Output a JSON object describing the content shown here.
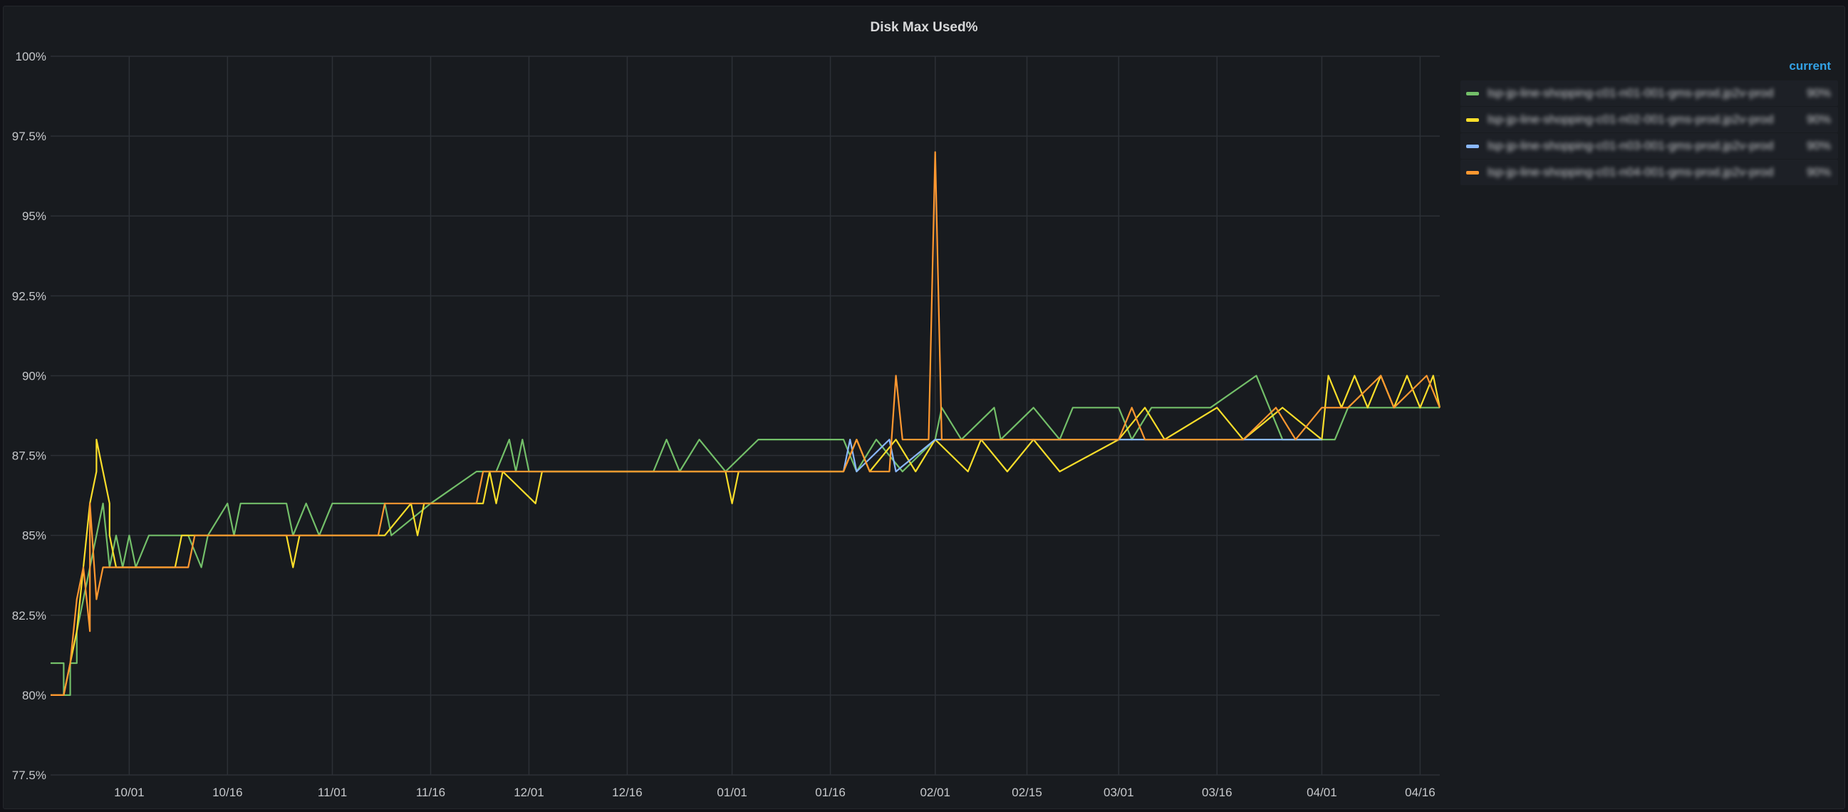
{
  "panel": {
    "title": "Disk Max Used%"
  },
  "legend": {
    "header": "current",
    "items": [
      {
        "name": "lsp-jp-line-shopping-c01-n01-001-gms-prod.jp2v-prod",
        "value": "90%",
        "color": "#73bf69"
      },
      {
        "name": "lsp-jp-line-shopping-c01-n02-001-gms-prod.jp2v-prod",
        "value": "90%",
        "color": "#fade2a"
      },
      {
        "name": "lsp-jp-line-shopping-c01-n03-001-gms-prod.jp2v-prod",
        "value": "90%",
        "color": "#8ab8ff"
      },
      {
        "name": "lsp-jp-line-shopping-c01-n04-001-gms-prod.jp2v-prod",
        "value": "90%",
        "color": "#ff9830"
      }
    ]
  },
  "chart_data": {
    "type": "line",
    "title": "Disk Max Used%",
    "y_ticks": [
      "77.5%",
      "80%",
      "82.5%",
      "85%",
      "87.5%",
      "90%",
      "92.5%",
      "95%",
      "97.5%",
      "100%"
    ],
    "x_ticks": [
      "10/01",
      "10/16",
      "11/01",
      "11/16",
      "12/01",
      "12/16",
      "01/01",
      "01/16",
      "02/01",
      "02/15",
      "03/01",
      "03/16",
      "04/01",
      "04/16"
    ],
    "ylim": [
      77.5,
      100
    ],
    "grid": true,
    "legend_position": "right",
    "series": [
      {
        "name": "lsp-jp-line-shopping-c01-n01-001-gms-prod.jp2v-prod",
        "color": "#73bf69",
        "points": [
          [
            "09/19",
            81
          ],
          [
            "09/21",
            81
          ],
          [
            "09/21",
            80
          ],
          [
            "09/22",
            80
          ],
          [
            "09/22",
            81
          ],
          [
            "09/23",
            81
          ],
          [
            "09/23",
            82
          ],
          [
            "09/24",
            83
          ],
          [
            "09/25",
            84
          ],
          [
            "09/26",
            85
          ],
          [
            "09/27",
            86
          ],
          [
            "09/28",
            84
          ],
          [
            "09/29",
            85
          ],
          [
            "09/30",
            84
          ],
          [
            "10/01",
            85
          ],
          [
            "10/02",
            84
          ],
          [
            "10/04",
            85
          ],
          [
            "10/10",
            85
          ],
          [
            "10/12",
            84
          ],
          [
            "10/13",
            85
          ],
          [
            "10/16",
            86
          ],
          [
            "10/17",
            85
          ],
          [
            "10/18",
            86
          ],
          [
            "10/25",
            86
          ],
          [
            "10/26",
            85
          ],
          [
            "10/28",
            86
          ],
          [
            "10/30",
            85
          ],
          [
            "11/01",
            86
          ],
          [
            "11/09",
            86
          ],
          [
            "11/10",
            85
          ],
          [
            "11/16",
            86
          ],
          [
            "11/23",
            87
          ],
          [
            "11/26",
            87
          ],
          [
            "11/28",
            88
          ],
          [
            "11/29",
            87
          ],
          [
            "11/30",
            88
          ],
          [
            "12/01",
            87
          ],
          [
            "12/20",
            87
          ],
          [
            "12/22",
            88
          ],
          [
            "12/24",
            87
          ],
          [
            "12/27",
            88
          ],
          [
            "12/31",
            87
          ],
          [
            "01/05",
            88
          ],
          [
            "01/18",
            88
          ],
          [
            "01/20",
            87
          ],
          [
            "01/23",
            88
          ],
          [
            "01/27",
            87
          ],
          [
            "02/01",
            88
          ],
          [
            "02/02",
            89
          ],
          [
            "02/05",
            88
          ],
          [
            "02/10",
            89
          ],
          [
            "02/11",
            88
          ],
          [
            "02/16",
            89
          ],
          [
            "02/20",
            88
          ],
          [
            "02/22",
            89
          ],
          [
            "03/01",
            89
          ],
          [
            "03/03",
            88
          ],
          [
            "03/06",
            89
          ],
          [
            "03/15",
            89
          ],
          [
            "03/22",
            90
          ],
          [
            "03/24",
            89
          ],
          [
            "03/26",
            88
          ],
          [
            "04/03",
            88
          ],
          [
            "04/05",
            89
          ],
          [
            "04/19",
            89
          ]
        ]
      },
      {
        "name": "lsp-jp-line-shopping-c01-n02-001-gms-prod.jp2v-prod",
        "color": "#fade2a",
        "points": [
          [
            "09/19",
            80
          ],
          [
            "09/21",
            80
          ],
          [
            "09/22",
            81
          ],
          [
            "09/23",
            82
          ],
          [
            "09/24",
            84
          ],
          [
            "09/25",
            86
          ],
          [
            "09/26",
            87
          ],
          [
            "09/26",
            88
          ],
          [
            "09/27",
            87
          ],
          [
            "09/28",
            86
          ],
          [
            "09/28",
            85
          ],
          [
            "09/29",
            84
          ],
          [
            "10/08",
            84
          ],
          [
            "10/09",
            85
          ],
          [
            "10/25",
            85
          ],
          [
            "10/26",
            84
          ],
          [
            "10/27",
            85
          ],
          [
            "11/09",
            85
          ],
          [
            "11/13",
            86
          ],
          [
            "11/14",
            85
          ],
          [
            "11/15",
            86
          ],
          [
            "11/24",
            86
          ],
          [
            "11/25",
            87
          ],
          [
            "11/26",
            86
          ],
          [
            "11/27",
            87
          ],
          [
            "12/02",
            86
          ],
          [
            "12/03",
            87
          ],
          [
            "12/31",
            87
          ],
          [
            "01/01",
            86
          ],
          [
            "01/02",
            87
          ],
          [
            "01/18",
            87
          ],
          [
            "01/20",
            88
          ],
          [
            "01/22",
            87
          ],
          [
            "01/26",
            88
          ],
          [
            "01/29",
            87
          ],
          [
            "02/01",
            88
          ],
          [
            "02/06",
            87
          ],
          [
            "02/08",
            88
          ],
          [
            "02/12",
            87
          ],
          [
            "02/16",
            88
          ],
          [
            "02/20",
            87
          ],
          [
            "03/01",
            88
          ],
          [
            "03/05",
            89
          ],
          [
            "03/08",
            88
          ],
          [
            "03/16",
            89
          ],
          [
            "03/20",
            88
          ],
          [
            "03/26",
            89
          ],
          [
            "04/01",
            88
          ],
          [
            "04/02",
            90
          ],
          [
            "04/04",
            89
          ],
          [
            "04/06",
            90
          ],
          [
            "04/08",
            89
          ],
          [
            "04/10",
            90
          ],
          [
            "04/12",
            89
          ],
          [
            "04/14",
            90
          ],
          [
            "04/16",
            89
          ],
          [
            "04/18",
            90
          ],
          [
            "04/19",
            89
          ]
        ]
      },
      {
        "name": "lsp-jp-line-shopping-c01-n03-001-gms-prod.jp2v-prod",
        "color": "#8ab8ff",
        "points": [
          [
            "01/18",
            87
          ],
          [
            "01/19",
            88
          ],
          [
            "01/20",
            87
          ],
          [
            "01/25",
            88
          ],
          [
            "01/26",
            87
          ],
          [
            "02/01",
            88
          ],
          [
            "04/01",
            88
          ]
        ]
      },
      {
        "name": "lsp-jp-line-shopping-c01-n04-001-gms-prod.jp2v-prod",
        "color": "#ff9830",
        "points": [
          [
            "09/19",
            80
          ],
          [
            "09/21",
            80
          ],
          [
            "09/22",
            81
          ],
          [
            "09/23",
            83
          ],
          [
            "09/24",
            84
          ],
          [
            "09/25",
            82
          ],
          [
            "09/25",
            86
          ],
          [
            "09/26",
            83
          ],
          [
            "09/27",
            84
          ],
          [
            "09/29",
            84
          ],
          [
            "10/10",
            84
          ],
          [
            "10/11",
            85
          ],
          [
            "11/08",
            85
          ],
          [
            "11/09",
            86
          ],
          [
            "11/23",
            86
          ],
          [
            "11/24",
            87
          ],
          [
            "01/18",
            87
          ],
          [
            "01/20",
            88
          ],
          [
            "01/22",
            87
          ],
          [
            "01/25",
            87
          ],
          [
            "01/26",
            90
          ],
          [
            "01/27",
            88
          ],
          [
            "01/31",
            88
          ],
          [
            "02/01",
            97
          ],
          [
            "02/02",
            88
          ],
          [
            "03/01",
            88
          ],
          [
            "03/03",
            89
          ],
          [
            "03/05",
            88
          ],
          [
            "03/20",
            88
          ],
          [
            "03/25",
            89
          ],
          [
            "03/28",
            88
          ],
          [
            "04/01",
            89
          ],
          [
            "04/05",
            89
          ],
          [
            "04/10",
            90
          ],
          [
            "04/12",
            89
          ],
          [
            "04/17",
            90
          ],
          [
            "04/19",
            89
          ]
        ]
      }
    ]
  }
}
